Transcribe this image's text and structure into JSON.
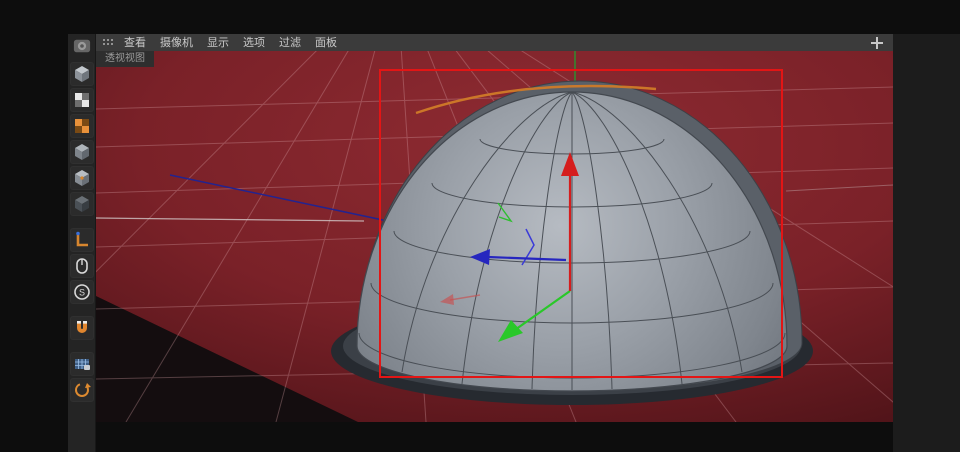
{
  "menubar": {
    "items": [
      "查看",
      "摄像机",
      "显示",
      "选项",
      "过滤",
      "面板"
    ]
  },
  "viewport": {
    "tab": "透视视图",
    "object": "hemisphere-dome",
    "selection": "red-bounding-rectangle"
  },
  "toolbar": {
    "s_glyph": "S",
    "icons": [
      "model-cube",
      "render-checker",
      "render-settings-checker",
      "object-cube",
      "object-cube-alt",
      "object-cube-dark",
      "workplane-axis",
      "mouse-input",
      "snap-s-circle",
      "magnet-snap",
      "mesh-grid-lock",
      "rotate-tool"
    ]
  },
  "colors": {
    "viewport_bg": "#7a2128",
    "grid_line": "#d9a3a8",
    "selection": "#e31515",
    "gizmo_up": "#d51d1d",
    "gizmo_green": "#29c829",
    "gizmo_blue": "#2626bf",
    "edge_highlight": "#d07a28",
    "menubar_bg": "#3b3b3b"
  }
}
